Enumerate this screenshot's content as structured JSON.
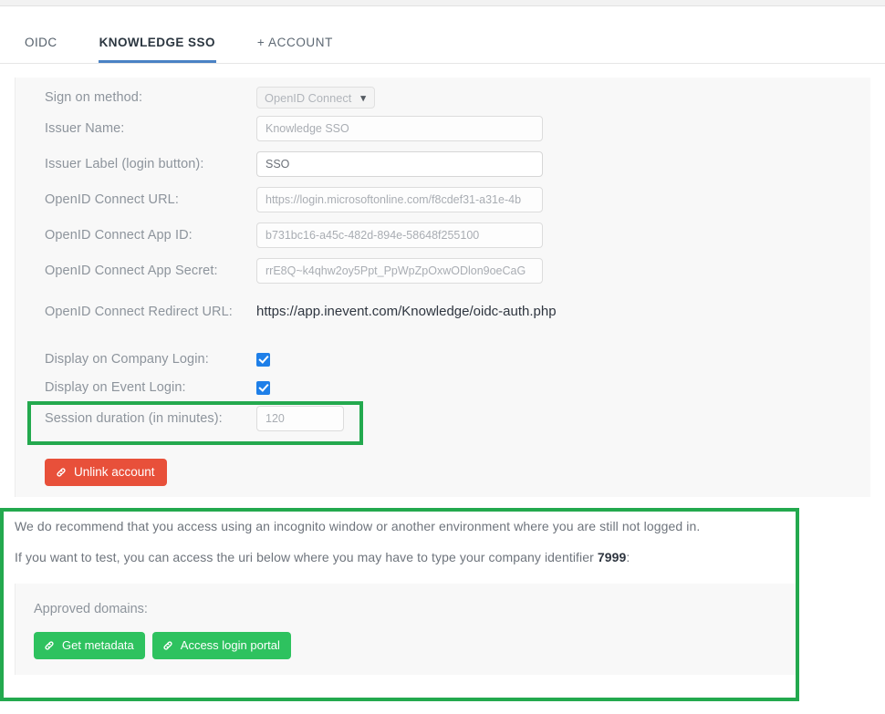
{
  "tabs": [
    {
      "label": "OIDC",
      "active": false
    },
    {
      "label": "KNOWLEDGE SSO",
      "active": true
    },
    {
      "label": "+ ACCOUNT",
      "active": false
    }
  ],
  "form": {
    "sign_on_method": {
      "label": "Sign on method:",
      "value": "OpenID Connect",
      "chevron": "⌄",
      "options": [
        "OpenID Connect"
      ]
    },
    "issuer_name": {
      "label": "Issuer Name:",
      "value": "Knowledge SSO",
      "placeholder": "Knowledge SSO"
    },
    "issuer_label": {
      "label": "Issuer Label (login button):",
      "value": "SSO",
      "placeholder": "SSO"
    },
    "connect_url": {
      "label": "OpenID Connect URL:",
      "value": "https://login.microsoftonline.com/f8cdef31-a31e-4b",
      "placeholder": "https://login.microsoftonline.com/f8cdef31-a31e-4b"
    },
    "app_id": {
      "label": "OpenID Connect App ID:",
      "value": "b731bc16-a45c-482d-894e-58648f255100",
      "placeholder": "b731bc16-a45c-482d-894e-58648f255100"
    },
    "app_secret": {
      "label": "OpenID Connect App Secret:",
      "value": "rrE8Q~k4qhw2oy5Ppt_PpWpZpOxwODlon9oeCaG",
      "placeholder": "rrE8Q~k4qhw2oy5Ppt_PpWpZpOxwODlon9oeCaG"
    },
    "redirect_url": {
      "label": "OpenID Connect Redirect URL:",
      "value": "https://app.inevent.com/Knowledge/oidc-auth.php"
    },
    "display_company_login": {
      "label": "Display on Company Login:",
      "checked": true
    },
    "display_event_login": {
      "label": "Display on Event Login:",
      "checked": true
    },
    "session_duration": {
      "label": "Session duration (in minutes):",
      "value": "120",
      "placeholder": "120"
    },
    "unlink_button": "Unlink account"
  },
  "info": {
    "line1": "We do recommend that you access using an incognito window or another environment where you are still not logged in.",
    "line2_pre": "If you want to test, you can access the uri below where you may have to type your company identifier ",
    "line2_bold": "7999",
    "line2_post": ":",
    "approved_domains_label": "Approved domains:",
    "get_metadata_button": "Get metadata",
    "access_login_portal_button": "Access login portal"
  },
  "colors": {
    "annotation_green": "#23a94e",
    "button_green": "#2ec25f",
    "button_red": "#e8503a",
    "checkbox_blue": "#1e7fe8",
    "active_tab_underline": "#4a82c4",
    "panel_bg": "#f8f8f8"
  }
}
